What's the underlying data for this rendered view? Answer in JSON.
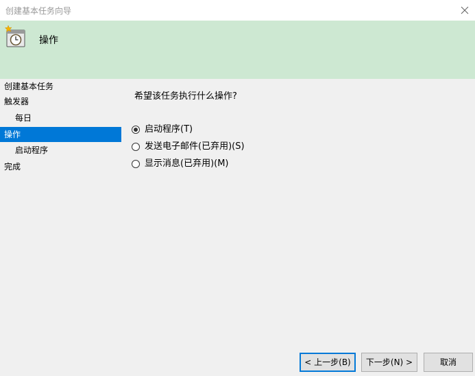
{
  "window": {
    "title": "创建基本任务向导"
  },
  "header": {
    "title": "操作",
    "icon": "task-scheduler-icon"
  },
  "nav": {
    "items": [
      {
        "label": "创建基本任务",
        "sub": false,
        "selected": false
      },
      {
        "label": "触发器",
        "sub": false,
        "selected": false
      },
      {
        "label": "每日",
        "sub": true,
        "selected": false
      },
      {
        "label": "操作",
        "sub": false,
        "selected": true
      },
      {
        "label": "启动程序",
        "sub": true,
        "selected": false
      },
      {
        "label": "完成",
        "sub": false,
        "selected": false
      }
    ]
  },
  "content": {
    "question": "希望该任务执行什么操作?",
    "options": [
      {
        "label": "启动程序(T)",
        "checked": true
      },
      {
        "label": "发送电子邮件(已弃用)(S)",
        "checked": false
      },
      {
        "label": "显示消息(已弃用)(M)",
        "checked": false
      }
    ]
  },
  "buttons": {
    "back": "< 上一步(B)",
    "next": "下一步(N) >",
    "cancel": "取消"
  },
  "colors": {
    "header_bg": "#cde8d2",
    "selection": "#0078d7",
    "window_bg": "#f0f0f0"
  }
}
